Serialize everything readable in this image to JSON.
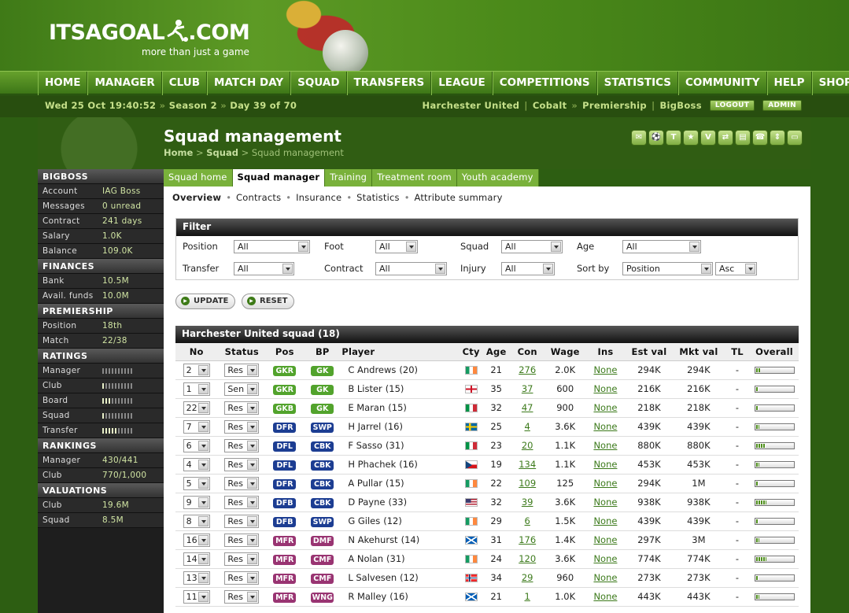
{
  "site": {
    "logo_text": "ITSAGOAL",
    "logo_suffix": ".COM",
    "tagline": "more than just a game"
  },
  "nav": [
    "HOME",
    "MANAGER",
    "CLUB",
    "MATCH DAY",
    "SQUAD",
    "TRANSFERS",
    "LEAGUE",
    "COMPETITIONS",
    "STATISTICS",
    "COMMUNITY",
    "HELP",
    "SHOP"
  ],
  "status": {
    "datetime": "Wed 25 Oct 19:40:52",
    "season": "Season 2",
    "day": "Day 39 of 70",
    "club": "Harchester United",
    "division": "Cobalt",
    "league": "Premiership",
    "user": "BigBoss",
    "logout": "LOGOUT",
    "admin": "ADMIN"
  },
  "page": {
    "title": "Squad management",
    "crumb_home": "Home",
    "crumb_squad": "Squad",
    "crumb_current": "Squad management"
  },
  "sidebar": [
    {
      "header": "BIGBOSS",
      "rows": [
        {
          "k": "Account",
          "v": "IAG Boss"
        },
        {
          "k": "Messages",
          "v": "0 unread"
        },
        {
          "k": "Contract",
          "v": "241 days"
        },
        {
          "k": "Salary",
          "v": "1.0K"
        },
        {
          "k": "Balance",
          "v": "109.0K"
        }
      ]
    },
    {
      "header": "FINANCES",
      "rows": [
        {
          "k": "Bank",
          "v": "10.5M"
        },
        {
          "k": "Avail. funds",
          "v": "10.0M"
        }
      ]
    },
    {
      "header": "PREMIERSHIP",
      "rows": [
        {
          "k": "Position",
          "v": "18th"
        },
        {
          "k": "Match",
          "v": "22/38"
        }
      ]
    },
    {
      "header": "RATINGS",
      "rows": [
        {
          "k": "Manager",
          "bar": 0.0
        },
        {
          "k": "Club",
          "bar": 0.1
        },
        {
          "k": "Board",
          "bar": 0.3
        },
        {
          "k": "Squad",
          "bar": 0.05
        },
        {
          "k": "Transfer",
          "bar": 0.5
        }
      ]
    },
    {
      "header": "RANKINGS",
      "rows": [
        {
          "k": "Manager",
          "v": "430/441"
        },
        {
          "k": "Club",
          "v": "770/1,000"
        }
      ]
    },
    {
      "header": "VALUATIONS",
      "rows": [
        {
          "k": "Club",
          "v": "19.6M"
        },
        {
          "k": "Squad",
          "v": "8.5M"
        }
      ]
    }
  ],
  "tabs": [
    "Squad home",
    "Squad manager",
    "Training",
    "Treatment room",
    "Youth academy"
  ],
  "subnav": [
    "Overview",
    "Contracts",
    "Insurance",
    "Statistics",
    "Attribute summary"
  ],
  "filter": {
    "title": "Filter",
    "labels": {
      "position": "Position",
      "foot": "Foot",
      "squad": "Squad",
      "age": "Age",
      "transfer": "Transfer",
      "contract": "Contract",
      "injury": "Injury",
      "sortby": "Sort by"
    },
    "values": {
      "position": "All",
      "foot": "All",
      "squad": "All",
      "age": "All",
      "transfer": "All",
      "contract": "All",
      "injury": "All",
      "sortby": "Position",
      "order": "Asc"
    },
    "update": "UPDATE",
    "reset": "RESET"
  },
  "squad": {
    "title": "Harchester United squad (18)",
    "columns": [
      "No",
      "Status",
      "Pos",
      "BP",
      "Player",
      "Cty",
      "Age",
      "Con",
      "Wage",
      "Ins",
      "Est val",
      "Mkt val",
      "TL",
      "Overall"
    ],
    "rows": [
      {
        "no": "2",
        "status": "Res",
        "pos": "GKR",
        "bp": "GK",
        "grp": "gk",
        "name": "C Andrews",
        "num": "(20)",
        "flag": "ie",
        "age": "21",
        "con": "276",
        "wage": "2.0K",
        "ins": "None",
        "est": "294K",
        "mkt": "294K",
        "tl": "-",
        "ovr": 0.12
      },
      {
        "no": "1",
        "status": "Sen",
        "pos": "GKR",
        "bp": "GK",
        "grp": "gk",
        "name": "B Lister",
        "num": "(15)",
        "flag": "en",
        "age": "35",
        "con": "37",
        "wage": "600",
        "ins": "None",
        "est": "216K",
        "mkt": "216K",
        "tl": "-",
        "ovr": 0.08
      },
      {
        "no": "22",
        "status": "Res",
        "pos": "GKB",
        "bp": "GK",
        "grp": "gk",
        "name": "E Maran",
        "num": "(15)",
        "flag": "it",
        "age": "32",
        "con": "47",
        "wage": "900",
        "ins": "None",
        "est": "218K",
        "mkt": "218K",
        "tl": "-",
        "ovr": 0.08
      },
      {
        "no": "7",
        "status": "Res",
        "pos": "DFR",
        "bp": "SWP",
        "grp": "df",
        "name": "H Jarrel",
        "num": "(16)",
        "flag": "se",
        "age": "25",
        "con": "4",
        "wage": "3.6K",
        "ins": "None",
        "est": "439K",
        "mkt": "439K",
        "tl": "-",
        "ovr": 0.1
      },
      {
        "no": "6",
        "status": "Res",
        "pos": "DFL",
        "bp": "CBK",
        "grp": "df",
        "name": "F Sasso",
        "num": "(31)",
        "flag": "it",
        "age": "23",
        "con": "20",
        "wage": "1.1K",
        "ins": "None",
        "est": "880K",
        "mkt": "880K",
        "tl": "-",
        "ovr": 0.25
      },
      {
        "no": "4",
        "status": "Res",
        "pos": "DFL",
        "bp": "CBK",
        "grp": "df",
        "name": "H Phachek",
        "num": "(16)",
        "flag": "cz",
        "age": "19",
        "con": "134",
        "wage": "1.1K",
        "ins": "None",
        "est": "453K",
        "mkt": "453K",
        "tl": "-",
        "ovr": 0.1
      },
      {
        "no": "5",
        "status": "Res",
        "pos": "DFR",
        "bp": "CBK",
        "grp": "df",
        "name": "A Pullar",
        "num": "(15)",
        "flag": "ie",
        "age": "22",
        "con": "109",
        "wage": "125",
        "ins": "None",
        "est": "294K",
        "mkt": "1M",
        "tl": "-",
        "ovr": 0.08
      },
      {
        "no": "9",
        "status": "Res",
        "pos": "DFB",
        "bp": "CBK",
        "grp": "df",
        "name": "D Payne",
        "num": "(33)",
        "flag": "us",
        "age": "32",
        "con": "39",
        "wage": "3.6K",
        "ins": "None",
        "est": "938K",
        "mkt": "938K",
        "tl": "-",
        "ovr": 0.28
      },
      {
        "no": "8",
        "status": "Res",
        "pos": "DFB",
        "bp": "SWP",
        "grp": "df",
        "name": "G Giles",
        "num": "(12)",
        "flag": "ie",
        "age": "29",
        "con": "6",
        "wage": "1.5K",
        "ins": "None",
        "est": "439K",
        "mkt": "439K",
        "tl": "-",
        "ovr": 0.08
      },
      {
        "no": "16",
        "status": "Res",
        "pos": "MFR",
        "bp": "DMF",
        "grp": "mf",
        "name": "N Akehurst",
        "num": "(14)",
        "flag": "sc",
        "age": "31",
        "con": "176",
        "wage": "1.4K",
        "ins": "None",
        "est": "297K",
        "mkt": "3M",
        "tl": "-",
        "ovr": 0.1
      },
      {
        "no": "14",
        "status": "Res",
        "pos": "MFR",
        "bp": "CMF",
        "grp": "mf",
        "name": "A Nolan",
        "num": "(31)",
        "flag": "ie",
        "age": "24",
        "con": "120",
        "wage": "3.6K",
        "ins": "None",
        "est": "774K",
        "mkt": "774K",
        "tl": "-",
        "ovr": 0.28
      },
      {
        "no": "13",
        "status": "Res",
        "pos": "MFR",
        "bp": "CMF",
        "grp": "mf",
        "name": "L Salvesen",
        "num": "(12)",
        "flag": "no2",
        "age": "34",
        "con": "29",
        "wage": "960",
        "ins": "None",
        "est": "273K",
        "mkt": "273K",
        "tl": "-",
        "ovr": 0.08
      },
      {
        "no": "11",
        "status": "Res",
        "pos": "MFR",
        "bp": "WNG",
        "grp": "mf",
        "name": "R Malley",
        "num": "(16)",
        "flag": "sc",
        "age": "21",
        "con": "1",
        "wage": "1.0K",
        "ins": "None",
        "est": "443K",
        "mkt": "443K",
        "tl": "-",
        "ovr": 0.1
      }
    ]
  },
  "icons": [
    "envelope-icon",
    "ball-icon",
    "shirt-icon",
    "star-icon",
    "v-icon",
    "transfer-icon",
    "card-icon",
    "phone-icon",
    "arrows-icon",
    "chat-icon"
  ]
}
